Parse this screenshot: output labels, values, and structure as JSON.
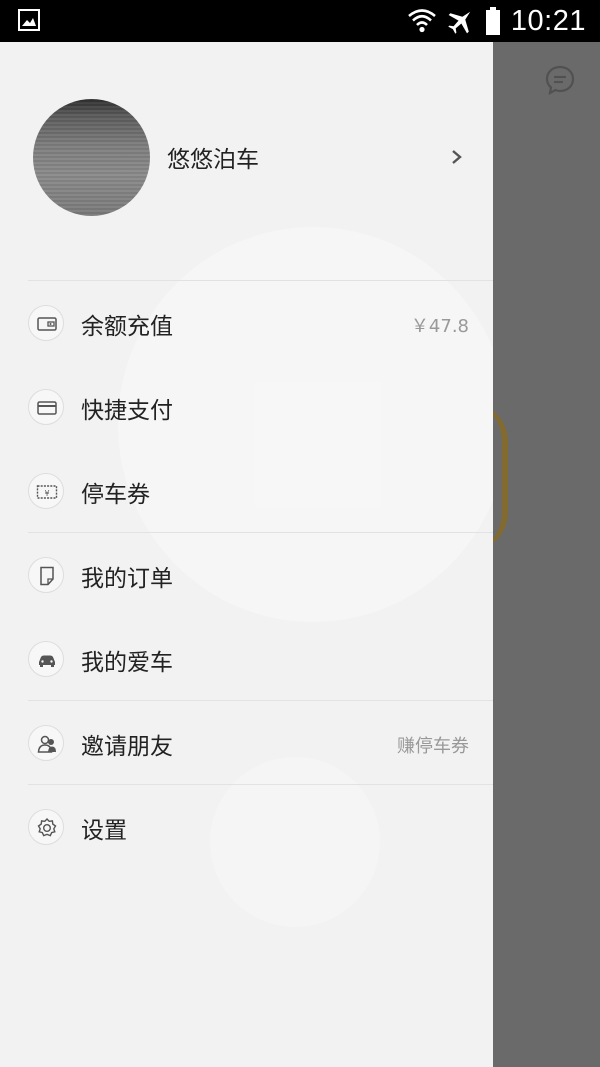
{
  "status_bar": {
    "time": "10:21",
    "icons": [
      "gallery-notification-icon",
      "wifi-icon",
      "airplane-mode-icon",
      "battery-icon"
    ]
  },
  "profile": {
    "name": "悠悠泊车"
  },
  "menu": [
    {
      "label": "余额充值",
      "value": "￥47.8",
      "icon": "wallet-icon"
    },
    {
      "label": "快捷支付",
      "value": "",
      "icon": "card-icon"
    },
    {
      "label": "停车券",
      "value": "",
      "icon": "coupon-icon"
    },
    {
      "label": "我的订单",
      "value": "",
      "icon": "order-icon"
    },
    {
      "label": "我的爱车",
      "value": "",
      "icon": "car-icon"
    },
    {
      "label": "邀请朋友",
      "value": "赚停车券",
      "icon": "invite-friends-icon"
    },
    {
      "label": "设置",
      "value": "",
      "icon": "settings-icon"
    }
  ],
  "colors": {
    "drawer_bg": "#f2f2f2",
    "overlay": "#6b6b6b",
    "text": "#222222",
    "secondary_text": "#999999"
  }
}
